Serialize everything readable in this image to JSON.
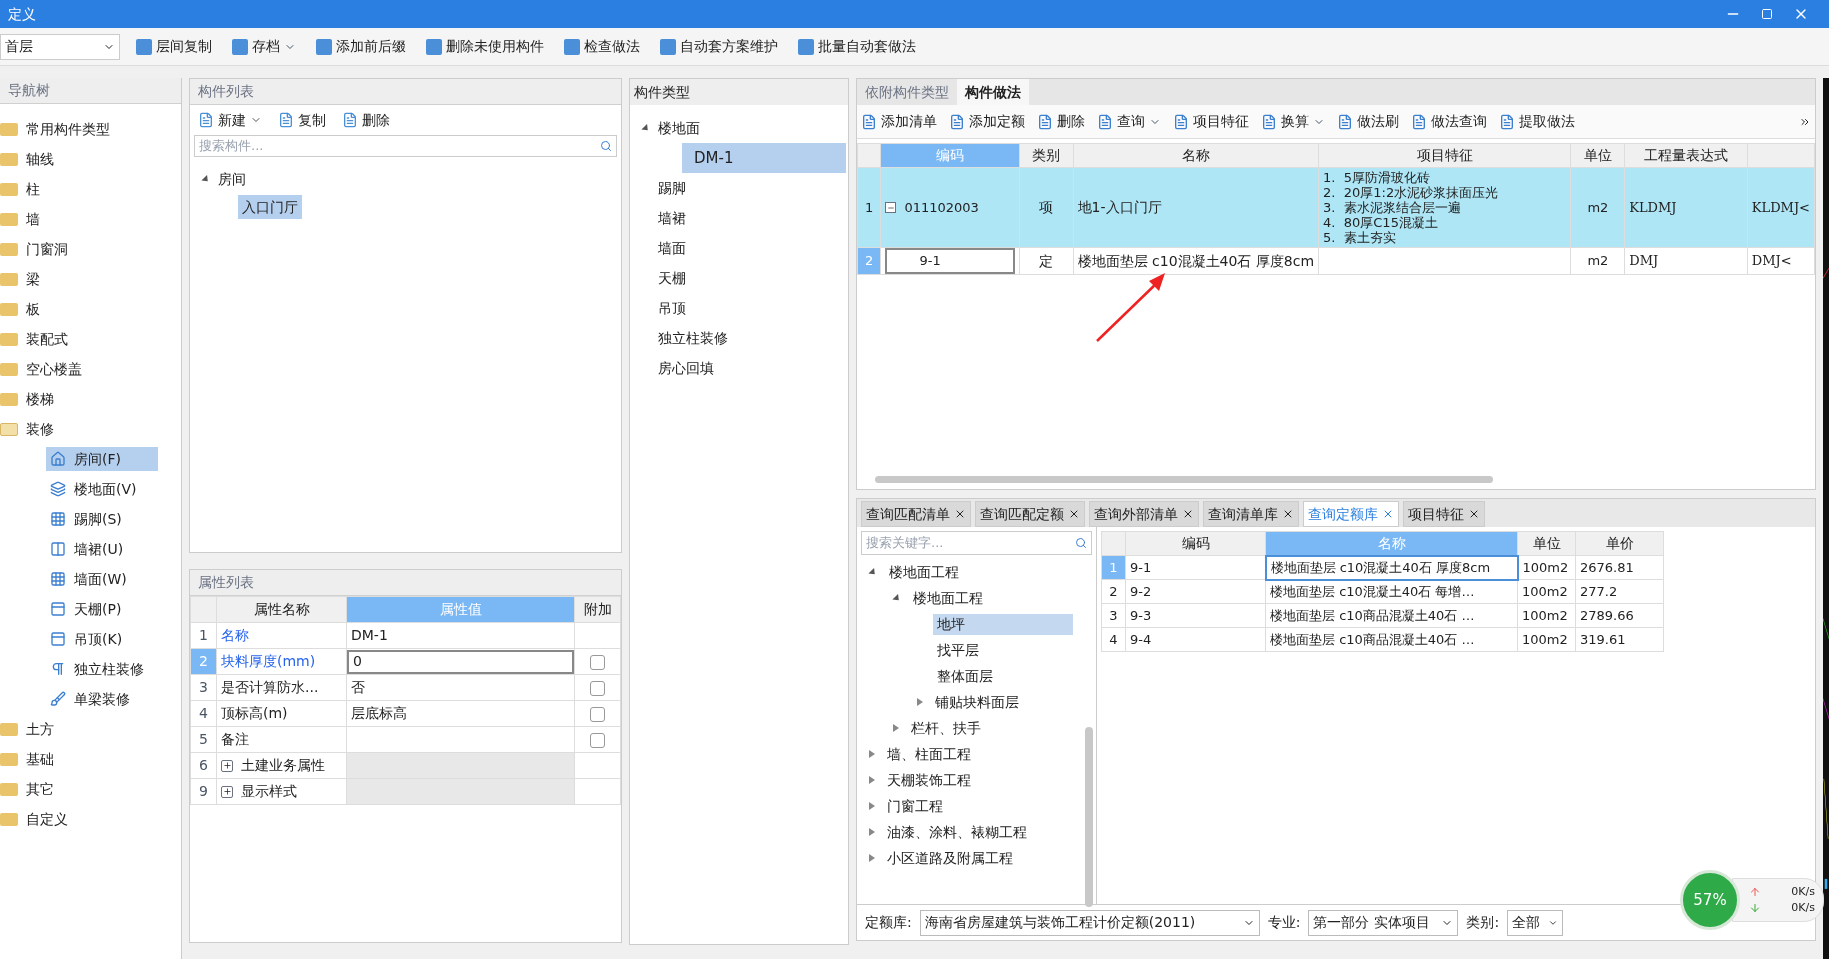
{
  "window": {
    "title": "定义"
  },
  "toolbar": {
    "floor": "首层",
    "buttons": [
      {
        "label": "层间复制",
        "dropdown": false
      },
      {
        "label": "存档",
        "dropdown": true
      },
      {
        "label": "添加前后缀",
        "dropdown": false
      },
      {
        "label": "删除未使用构件",
        "dropdown": false
      },
      {
        "label": "检查做法",
        "dropdown": false
      },
      {
        "label": "自动套方案维护",
        "dropdown": false
      },
      {
        "label": "批量自动套做法",
        "dropdown": false
      }
    ]
  },
  "nav_tree": {
    "title": "导航树",
    "items": [
      {
        "label": "常用构件类型",
        "expanded": false
      },
      {
        "label": "轴线",
        "expanded": false
      },
      {
        "label": "柱",
        "expanded": false
      },
      {
        "label": "墙",
        "expanded": false
      },
      {
        "label": "门窗洞",
        "expanded": false
      },
      {
        "label": "梁",
        "expanded": false
      },
      {
        "label": "板",
        "expanded": false
      },
      {
        "label": "装配式",
        "expanded": false
      },
      {
        "label": "空心楼盖",
        "expanded": false
      },
      {
        "label": "楼梯",
        "expanded": false
      },
      {
        "label": "装修",
        "expanded": true,
        "children": [
          {
            "label": "房间(F)",
            "selected": true
          },
          {
            "label": "楼地面(V)",
            "selected": false
          },
          {
            "label": "踢脚(S)",
            "selected": false
          },
          {
            "label": "墙裙(U)",
            "selected": false
          },
          {
            "label": "墙面(W)",
            "selected": false
          },
          {
            "label": "天棚(P)",
            "selected": false
          },
          {
            "label": "吊顶(K)",
            "selected": false
          },
          {
            "label": "独立柱装修",
            "selected": false
          },
          {
            "label": "单梁装修",
            "selected": false
          }
        ]
      },
      {
        "label": "土方",
        "expanded": false
      },
      {
        "label": "基础",
        "expanded": false
      },
      {
        "label": "其它",
        "expanded": false
      },
      {
        "label": "自定义",
        "expanded": false
      }
    ]
  },
  "component_list": {
    "title": "构件列表",
    "buttons": [
      {
        "label": "新建",
        "dropdown": true
      },
      {
        "label": "复制",
        "dropdown": false
      },
      {
        "label": "删除",
        "dropdown": false
      }
    ],
    "search": {
      "placeholder": "搜索构件..."
    },
    "tree": [
      {
        "label": "房间",
        "expanded": true,
        "children": [
          {
            "label": "入口门厅",
            "selected": true
          }
        ]
      }
    ]
  },
  "properties": {
    "title": "属性列表",
    "columns": [
      "属性名称",
      "属性值",
      "附加"
    ],
    "rows": [
      {
        "index": "1",
        "name": "名称",
        "value": "DM-1",
        "kind": "field",
        "public": true,
        "selected": false
      },
      {
        "index": "2",
        "name": "块料厚度(mm)",
        "value": "0",
        "kind": "field",
        "public": true,
        "selected": true,
        "checked": false
      },
      {
        "index": "3",
        "name": "是否计算防水...",
        "value": "否",
        "kind": "field",
        "public": false,
        "selected": false,
        "checked": false
      },
      {
        "index": "4",
        "name": "顶标高(m)",
        "value": "层底标高",
        "kind": "field",
        "public": false,
        "selected": false,
        "checked": false
      },
      {
        "index": "5",
        "name": "备注",
        "kind": "field",
        "public": false,
        "selected": false,
        "checked": false
      },
      {
        "index": "6",
        "name": "土建业务属性",
        "kind": "group",
        "public": false,
        "selected": false,
        "expanded": false
      },
      {
        "index": "9",
        "name": "显示样式",
        "kind": "group",
        "public": false,
        "selected": false,
        "expanded": false
      }
    ]
  },
  "component_types": {
    "title": "构件类型",
    "items": [
      {
        "label": "楼地面",
        "expanded": true,
        "children": [
          {
            "label": "DM-1",
            "selected": true
          }
        ]
      },
      {
        "label": "踢脚"
      },
      {
        "label": "墙裙"
      },
      {
        "label": "墙面"
      },
      {
        "label": "天棚"
      },
      {
        "label": "吊顶"
      },
      {
        "label": "独立柱装修"
      },
      {
        "label": "房心回填"
      }
    ]
  },
  "method_panel": {
    "tabs": [
      {
        "label": "依附构件类型",
        "selected": false
      },
      {
        "label": "构件做法",
        "selected": true
      }
    ],
    "buttons": [
      {
        "label": "添加清单",
        "dropdown": false
      },
      {
        "label": "添加定额",
        "dropdown": false
      },
      {
        "label": "删除",
        "dropdown": false
      },
      {
        "label": "查询",
        "dropdown": true
      },
      {
        "label": "项目特征",
        "dropdown": false
      },
      {
        "label": "换算",
        "dropdown": true
      },
      {
        "label": "做法刷",
        "dropdown": false
      },
      {
        "label": "做法查询",
        "dropdown": false
      },
      {
        "label": "提取做法",
        "dropdown": false
      }
    ],
    "columns": [
      "编码",
      "类别",
      "名称",
      "项目特征",
      "单位",
      "工程量表达式"
    ],
    "rows": [
      {
        "index": "1",
        "kind": "bill",
        "expanded": true,
        "selected": false,
        "code": "011102003",
        "type": "项",
        "name": "地1-入口门厅",
        "features": [
          "1.  5厚防滑玻化砖",
          "2.  20厚1:2水泥砂浆抹面压光",
          "3.  素水泥浆结合层一遍",
          "4.  80厚C15混凝土",
          "5.  素土夯实"
        ],
        "unit": "m2",
        "expression": "KLDMJ",
        "column_7": "KLDMJ<"
      },
      {
        "index": "2",
        "kind": "quota",
        "selected": true,
        "code": "9-1",
        "type": "定",
        "name": "楼地面垫层 c10混凝土40石 厚度8cm",
        "unit": "m2",
        "expression": "DMJ",
        "column_7": "DMJ<"
      }
    ]
  },
  "query_panel": {
    "tabs": [
      {
        "label": "查询匹配清单",
        "selected": false
      },
      {
        "label": "查询匹配定额",
        "selected": false
      },
      {
        "label": "查询外部清单",
        "selected": false
      },
      {
        "label": "查询清单库",
        "selected": false
      },
      {
        "label": "查询定额库",
        "selected": true
      },
      {
        "label": "项目特征",
        "selected": false
      }
    ],
    "search": {
      "placeholder": "搜索关键字..."
    },
    "tree": [
      {
        "label": "楼地面工程",
        "expanded": true,
        "children": [
          {
            "label": "楼地面工程",
            "expanded": true,
            "children": [
              {
                "label": "地坪",
                "selected": true
              },
              {
                "label": "找平层",
                "selected": false
              },
              {
                "label": "整体面层",
                "selected": false
              },
              {
                "label": "铺贴块料面层",
                "selected": false,
                "expanded": false
              }
            ]
          },
          {
            "label": "栏杆、扶手",
            "expanded": false
          }
        ]
      },
      {
        "label": "墙、柱面工程",
        "expanded": false
      },
      {
        "label": "天棚装饰工程",
        "expanded": false
      },
      {
        "label": "门窗工程",
        "expanded": false
      },
      {
        "label": "油漆、涂料、裱糊工程",
        "expanded": false
      },
      {
        "label": "小区道路及附属工程",
        "expanded": false
      }
    ],
    "columns": [
      "编码",
      "名称",
      "单位",
      "单价"
    ],
    "rows": [
      {
        "index": "1",
        "code": "9-1",
        "name": "楼地面垫层 c10混凝土40石 厚度8cm",
        "unit": "100m2",
        "price": "2676.81",
        "selected": true
      },
      {
        "index": "2",
        "code": "9-2",
        "name": "楼地面垫层 c10混凝土40石 每增…",
        "unit": "100m2",
        "price": "277.2",
        "selected": false
      },
      {
        "index": "3",
        "code": "9-3",
        "name": "楼地面垫层 c10商品混凝土40石 …",
        "unit": "100m2",
        "price": "2789.66",
        "selected": false
      },
      {
        "index": "4",
        "code": "9-4",
        "name": "楼地面垫层 c10商品混凝土40石 …",
        "unit": "100m2",
        "price": "319.61",
        "selected": false
      }
    ],
    "footer": [
      {
        "label": "定额库:",
        "value": "海南省房屋建筑与装饰工程计价定额(2011)"
      },
      {
        "label": "专业:",
        "value": "第一部分 实体项目"
      },
      {
        "label": "类别:",
        "value": "全部"
      }
    ]
  },
  "monitor": {
    "percent": "57%",
    "upload": "0K/s",
    "download": "0K/s"
  }
}
